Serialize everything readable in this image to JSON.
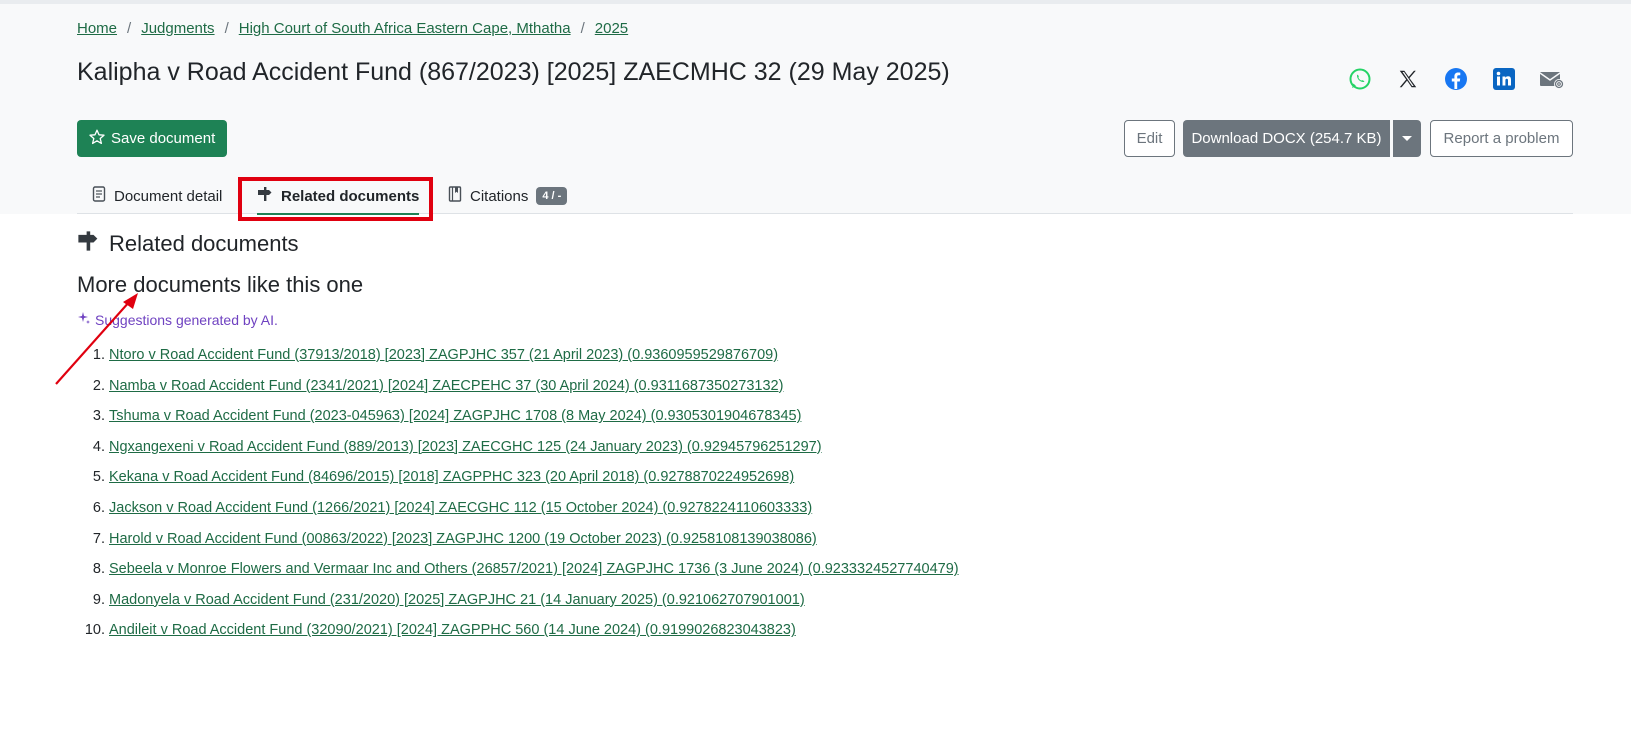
{
  "breadcrumb": [
    {
      "label": "Home"
    },
    {
      "label": "Judgments"
    },
    {
      "label": "High Court of South Africa Eastern Cape, Mthatha"
    },
    {
      "label": "2025"
    }
  ],
  "page_title": "Kalipha v Road Accident Fund (867/2023) [2025] ZAECMHC 32 (29 May 2025)",
  "share_icons": [
    "whatsapp-icon",
    "x-icon",
    "facebook-icon",
    "linkedin-icon",
    "email-icon"
  ],
  "actions": {
    "save_label": "Save document",
    "edit_label": "Edit",
    "download_label": "Download DOCX (254.7 KB)",
    "report_label": "Report a problem"
  },
  "tabs": [
    {
      "label": "Document detail"
    },
    {
      "label": "Related documents",
      "active": true
    },
    {
      "label": "Citations",
      "badge": "4 / -"
    }
  ],
  "section": {
    "heading": "Related documents",
    "subheading": "More documents like this one",
    "ai_note": "Suggestions generated by AI."
  },
  "documents": [
    {
      "num": "1.",
      "title": "Ntoro v Road Accident Fund (37913/2018) [2023] ZAGPJHC 357 (21 April 2023) (0.9360959529876709)"
    },
    {
      "num": "2.",
      "title": "Namba v Road Accident Fund (2341/2021) [2024] ZAECPEHC 37 (30 April 2024) (0.9311687350273132)"
    },
    {
      "num": "3.",
      "title": "Tshuma v Road Accident Fund (2023-045963) [2024] ZAGPJHC 1708 (8 May 2024) (0.9305301904678345)"
    },
    {
      "num": "4.",
      "title": "Ngxangexeni v Road Accident Fund (889/2013) [2023] ZAECGHC 125 (24 January 2023) (0.92945796251297)"
    },
    {
      "num": "5.",
      "title": "Kekana v Road Accident Fund (84696/2015) [2018] ZAGPPHC 323 (20 April 2018) (0.9278870224952698)"
    },
    {
      "num": "6.",
      "title": "Jackson v Road Accident Fund (1266/2021) [2024] ZAECGHC 112 (15 October 2024) (0.9278224110603333)"
    },
    {
      "num": "7.",
      "title": "Harold v Road Accident Fund (00863/2022) [2023] ZAGPJHC 1200 (19 October 2023) (0.9258108139038086)"
    },
    {
      "num": "8.",
      "title": "Sebeela v Monroe Flowers and Vermaar Inc and Others (26857/2021) [2024] ZAGPJHC 1736 (3 June 2024) (0.9233324527740479)"
    },
    {
      "num": "9.",
      "title": "Madonyela v Road Accident Fund (231/2020) [2025] ZAGPJHC 21 (14 January 2025) (0.921062707901001)"
    },
    {
      "num": "10.",
      "title": "Andileit v Road Accident Fund (32090/2021) [2024] ZAGPPHC 560 (14 June 2024) (0.9199026823043823)"
    }
  ],
  "colors": {
    "accent": "#1e8255",
    "link": "#1e6b45",
    "highlight": "#e0000f",
    "ai": "#6f42c1"
  }
}
